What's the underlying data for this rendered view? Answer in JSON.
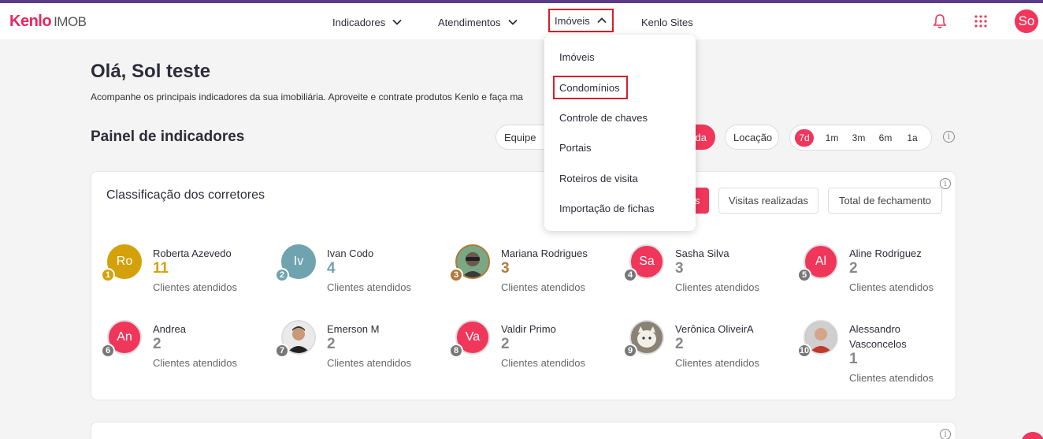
{
  "header": {
    "logo_brand": "Kenlo",
    "logo_product": "IMOB",
    "nav": [
      {
        "label": "Indicadores"
      },
      {
        "label": "Atendimentos"
      },
      {
        "label": "Imóveis"
      },
      {
        "label": "Kenlo Sites"
      }
    ],
    "user_initials": "So"
  },
  "greeting": "Olá, Sol teste",
  "subtitle": "Acompanhe os principais indicadores da sua imobiliária. Aproveite e contrate produtos Kenlo e faça ma",
  "panel": {
    "title": "Painel de indicadores",
    "team_filter": "Equipe",
    "mode_partial": "da",
    "mode_rent": "Locação",
    "periods": [
      "7d",
      "1m",
      "3m",
      "6m",
      "1a"
    ],
    "selected_period": "7d"
  },
  "ranking": {
    "title": "Classificação dos corretores",
    "filters": [
      "s",
      "Visitas realizadas",
      "Total de fechamento"
    ],
    "brokers": [
      {
        "rank": "1",
        "initials": "Ro",
        "name": "Roberta Azevedo",
        "count": "11",
        "label": "Clientes atendidos",
        "color": "#d4a10b"
      },
      {
        "rank": "2",
        "initials": "Iv",
        "name": "Ivan Codo",
        "count": "4",
        "label": "Clientes atendidos",
        "color": "#6fa3b0"
      },
      {
        "rank": "3",
        "initials": "",
        "name": "Mariana Rodrigues",
        "count": "3",
        "label": "Clientes atendidos",
        "color": "#5a8f6a"
      },
      {
        "rank": "4",
        "initials": "Sa",
        "name": "Sasha Silva",
        "count": "3",
        "label": "Clientes atendidos",
        "color": "#f0365a"
      },
      {
        "rank": "5",
        "initials": "Al",
        "name": "Aline Rodriguez",
        "count": "2",
        "label": "Clientes atendidos",
        "color": "#f0365a"
      },
      {
        "rank": "6",
        "initials": "An",
        "name": "Andrea",
        "count": "2",
        "label": "Clientes atendidos",
        "color": "#f0365a"
      },
      {
        "rank": "7",
        "initials": "",
        "name": "Emerson M",
        "count": "2",
        "label": "Clientes atendidos",
        "color": "#3a3a3a"
      },
      {
        "rank": "8",
        "initials": "Va",
        "name": "Valdir Primo",
        "count": "2",
        "label": "Clientes atendidos",
        "color": "#f0365a"
      },
      {
        "rank": "9",
        "initials": "",
        "name": "Verônica OliveirA",
        "count": "2",
        "label": "Clientes atendidos",
        "color": "#a09a90"
      },
      {
        "rank": "10",
        "initials": "",
        "name": "Alessandro Vasconcelos",
        "count": "1",
        "label": "Clientes atendidos",
        "color": "#b54a3a"
      }
    ]
  },
  "dropdown": {
    "items": [
      "Imóveis",
      "Condomínios",
      "Controle de chaves",
      "Portais",
      "Roteiros de visita",
      "Importação de fichas"
    ]
  },
  "colors": {
    "accent": "#f0365a",
    "highlight_border": "#d3202a",
    "gold": "#d4a10b",
    "teal": "#6fa3b0",
    "bronze": "#b07a3a"
  }
}
